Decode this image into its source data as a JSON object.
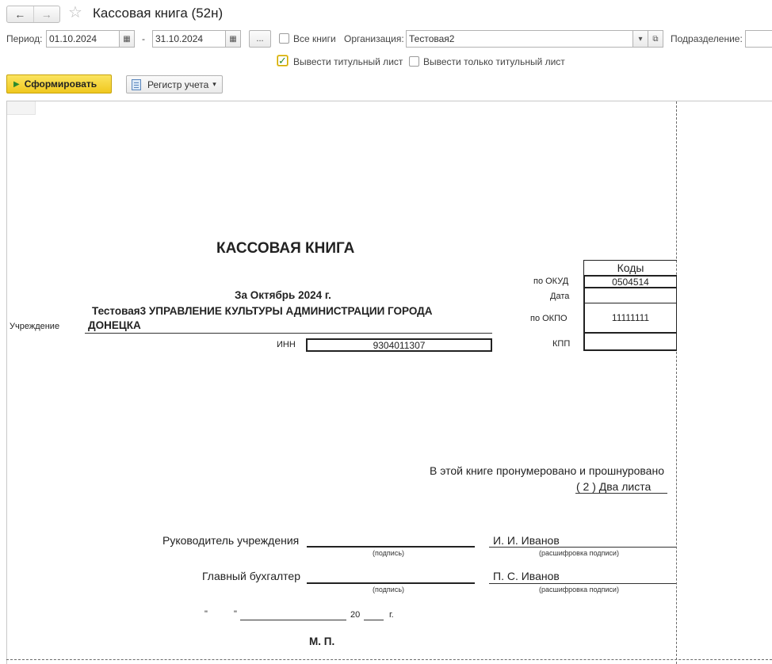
{
  "window": {
    "title": "Кассовая книга (52н)"
  },
  "nav": {
    "back": "←",
    "forward": "→",
    "star": "☆"
  },
  "filters": {
    "period_label": "Период:",
    "date_from": "01.10.2024",
    "dash": "-",
    "date_to": "31.10.2024",
    "dots": "...",
    "all_books_label": "Все книги",
    "org_label": "Организация:",
    "org_value": "Тестовая2",
    "subdivision_label": "Подразделение:",
    "print_title_label": "Вывести титульный лист",
    "print_title_checked": true,
    "print_only_title_label": "Вывести только титульный лист",
    "print_only_title_checked": false
  },
  "buttons": {
    "generate": "Сформировать",
    "register": "Регистр учета"
  },
  "icons": {
    "calendar": "▦",
    "dropdown": "▾",
    "open": "⧉",
    "play": "▶",
    "check": "✓"
  },
  "report": {
    "title": "КАССОВАЯ КНИГА",
    "period": "За Октябрь 2024 г.",
    "org_line1": "Тестовая3 УПРАВЛЕНИЕ КУЛЬТУРЫ АДМИНИСТРАЦИИ ГОРОДА",
    "org_line2": "ДОНЕЦКА",
    "institution_label": "Учреждение",
    "inn_label": "ИНН",
    "inn_value": "9304011307",
    "codes_header": "Коды",
    "okud_label": "по ОКУД",
    "okud_value": "0504514",
    "date_label": "Дата",
    "date_value": "",
    "okpo_label": "по ОКПО",
    "okpo_value": "11111111",
    "kpp_label": "КПП",
    "kpp_value": "",
    "numbered_text": "В этой книге пронумеровано и прошнуровано",
    "pages_text": "( 2 )  Два листа",
    "head_label": "Руководитель учреждения",
    "head_name": "И. И. Иванов",
    "accountant_label": "Главный бухгалтер",
    "accountant_name": "П. С. Иванов",
    "signature_caption": "(подпись)",
    "signature_decode_caption": "(расшифровка подписи)",
    "date_quote_open": "\"",
    "date_quote_close": "\"",
    "year_prefix": "20",
    "year_suffix": "г.",
    "stamp": "М. П."
  }
}
